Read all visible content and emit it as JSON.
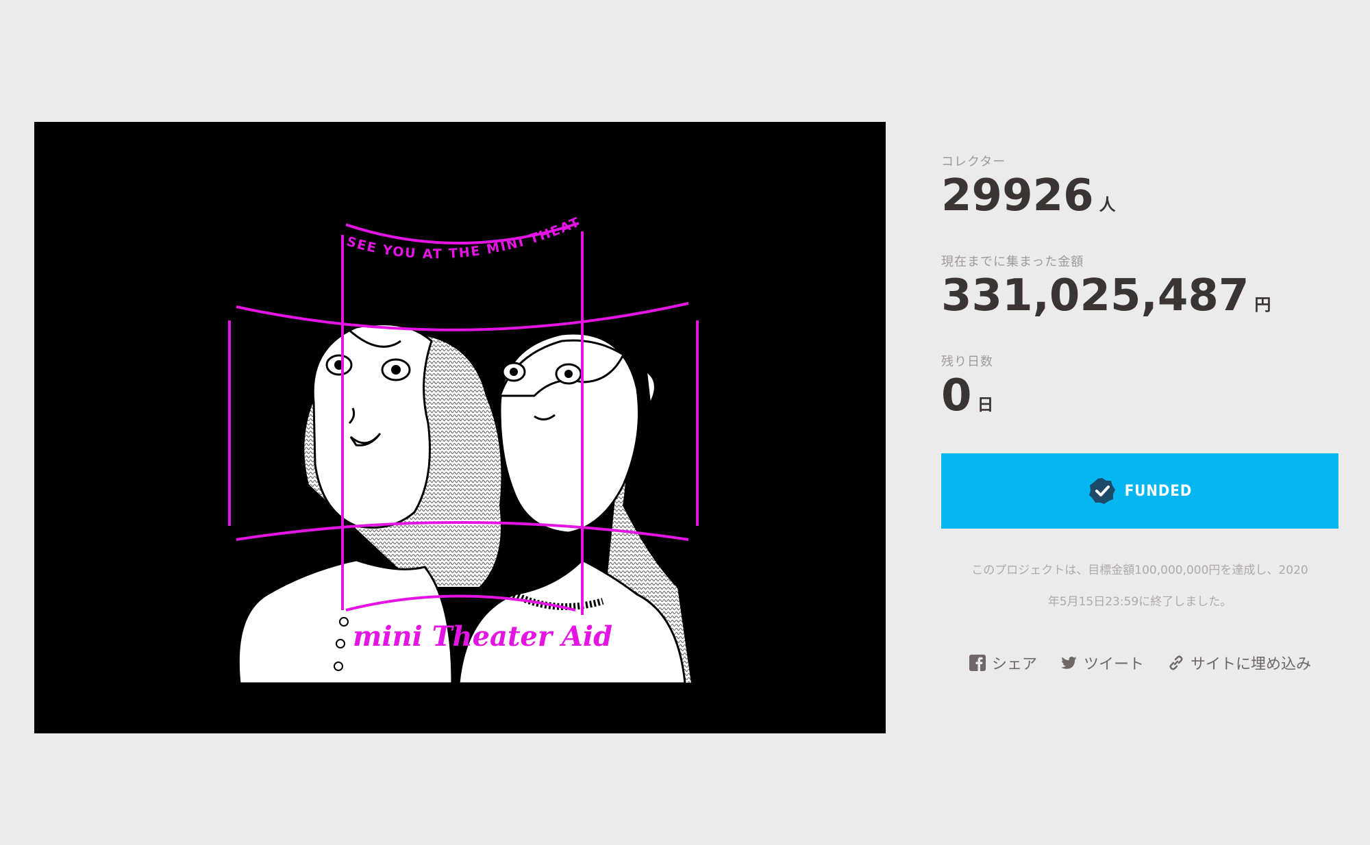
{
  "hero": {
    "top_text": "SEE YOU AT THE MINI THEATER.",
    "bottom_text": "mini Theater Aid"
  },
  "stats": {
    "collectors_label": "コレクター",
    "collectors_value": "29926",
    "collectors_unit": "人",
    "raised_label": "現在までに集まった金額",
    "raised_value": "331,025,487",
    "raised_unit": "円",
    "remaining_label": "残り日数",
    "remaining_value": "0",
    "remaining_unit": "日"
  },
  "funded": {
    "label": "FUNDED",
    "note_line1": "このプロジェクトは、目標金額100,000,000円を達成し、2020",
    "note_line2": "年5月15日23:59に終了しました。"
  },
  "share": {
    "facebook_label": "シェア",
    "twitter_label": "ツイート",
    "embed_label": "サイトに埋め込み"
  },
  "colors": {
    "page_bg": "#ebebeb",
    "accent_blue": "#06b6f0",
    "magenta": "#e414e4",
    "text_dark": "#3a3433",
    "text_muted": "#a09a99",
    "badge_dark": "#1e4a6a"
  },
  "icons": {
    "funded": "check-badge-icon",
    "facebook": "facebook-icon",
    "twitter": "twitter-icon",
    "embed": "link-icon"
  }
}
